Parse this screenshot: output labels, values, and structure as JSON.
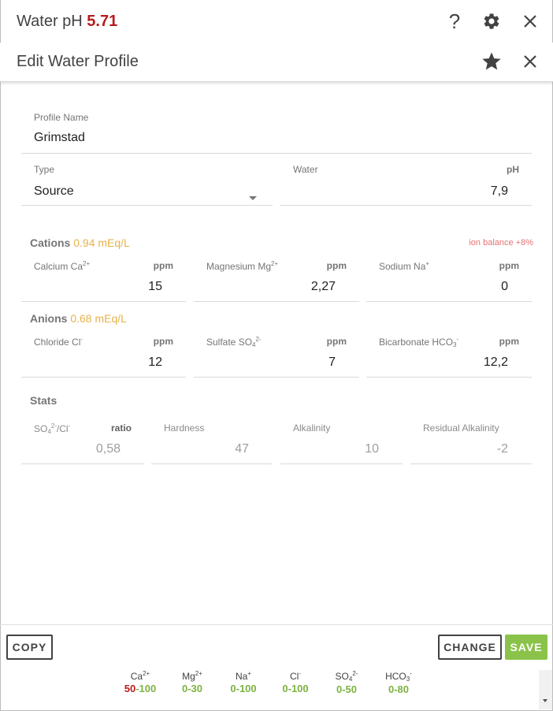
{
  "app": {
    "title_prefix": "Water pH",
    "ph_value": "5.71"
  },
  "header": {
    "title": "Edit Water Profile"
  },
  "profile": {
    "name_label": "Profile Name",
    "name_value": "Grimstad",
    "type_label": "Type",
    "type_value": "Source",
    "water_label": "Water",
    "ph_label": "pH",
    "ph_value": "7,9"
  },
  "cations": {
    "title": "Cations",
    "meq": "0.94 mEq/L",
    "ion_balance": "ion balance +8%",
    "fields": [
      {
        "label": "Calcium Ca",
        "sup": "2+",
        "unit": "ppm",
        "value": "15"
      },
      {
        "label": "Magnesium Mg",
        "sup": "2+",
        "unit": "ppm",
        "value": "2,27"
      },
      {
        "label": "Sodium Na",
        "sup": "+",
        "unit": "ppm",
        "value": "0"
      }
    ]
  },
  "anions": {
    "title": "Anions",
    "meq": "0.68 mEq/L",
    "fields": [
      {
        "label": "Chloride Cl",
        "sup": "-",
        "unit": "ppm",
        "value": "12"
      },
      {
        "label": "Sulfate SO",
        "sub": "4",
        "sup": "2-",
        "unit": "ppm",
        "value": "7"
      },
      {
        "label": "Bicarbonate HCO",
        "sub": "3",
        "sup": "-",
        "unit": "ppm",
        "value": "12,2"
      }
    ]
  },
  "stats": {
    "title": "Stats",
    "ratio_label_a": "SO",
    "ratio_label_sub": "4",
    "ratio_label_sup": "2-",
    "ratio_label_b": "/Cl",
    "ratio_label_sup2": "-",
    "ratio_unit": "ratio",
    "ratio_value": "0,58",
    "hardness_label": "Hardness",
    "hardness_value": "47",
    "alkalinity_label": "Alkalinity",
    "alkalinity_value": "10",
    "residual_label": "Residual Alkalinity",
    "residual_value": "-2"
  },
  "buttons": {
    "copy": "COPY",
    "change": "CHANGE",
    "save": "SAVE"
  },
  "ranges": [
    {
      "ion": "Ca",
      "sup": "2+",
      "low": "50",
      "high": "100",
      "low_flag": true
    },
    {
      "ion": "Mg",
      "sup": "2+",
      "low": "0",
      "high": "30",
      "low_flag": false
    },
    {
      "ion": "Na",
      "sup": "+",
      "low": "0",
      "high": "100",
      "low_flag": false
    },
    {
      "ion": "Cl",
      "sup": "-",
      "low": "0",
      "high": "100",
      "low_flag": false
    },
    {
      "ion": "SO",
      "sub": "4",
      "sup": "2-",
      "low": "0",
      "high": "50",
      "low_flag": false
    },
    {
      "ion": "HCO",
      "sub": "3",
      "sup": "-",
      "low": "0",
      "high": "80",
      "low_flag": false
    }
  ],
  "colors": {
    "accent": "#8bc34a",
    "ph_red": "#b71c1c",
    "meq_yellow": "#e6b34a",
    "warning_pink": "#e57373"
  },
  "icons": [
    "help-icon",
    "gear-icon",
    "close-icon",
    "star-icon"
  ]
}
